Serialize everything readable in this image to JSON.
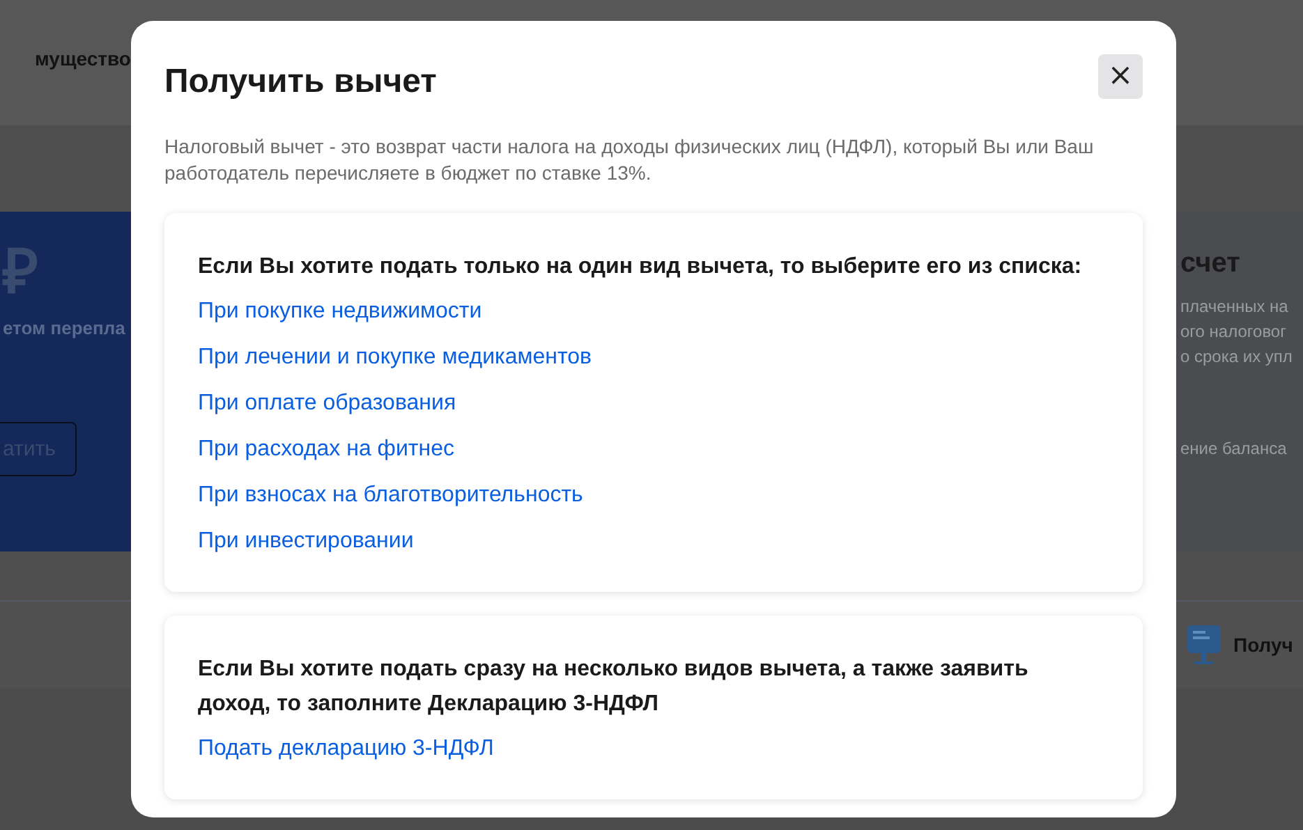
{
  "background": {
    "header_text": "мущество",
    "banner": {
      "currency_symbol": "₽",
      "subtitle": "етом перепла",
      "button": "атить"
    },
    "side_card": {
      "title": "счет",
      "lines": [
        "плаченных на",
        "ого налоговог",
        "о срока их упл"
      ],
      "footer": "ение баланса"
    },
    "bottom": {
      "label": "Получ"
    }
  },
  "dialog": {
    "title": "Получить вычет",
    "close": "×",
    "description": "Налоговый вычет - это возврат части налога на доходы физических лиц (НДФЛ), который Вы или Ваш работодатель перечисляете в бюджет по ставке 13%.",
    "sections": [
      {
        "heading": "Если Вы хотите подать только на один вид вычета, то выберите его из списка:",
        "links": [
          "При покупке недвижимости",
          "При лечении и покупке медикаментов",
          "При оплате образования",
          "При расходах на фитнес",
          "При взносах на благотворительность",
          "При инвестировании"
        ]
      },
      {
        "heading": "Если Вы хотите подать сразу на несколько видов вычета, а также заявить доход, то заполните Декларацию 3-НДФЛ",
        "links": [
          "Подать декларацию 3-НДФЛ"
        ]
      }
    ]
  }
}
